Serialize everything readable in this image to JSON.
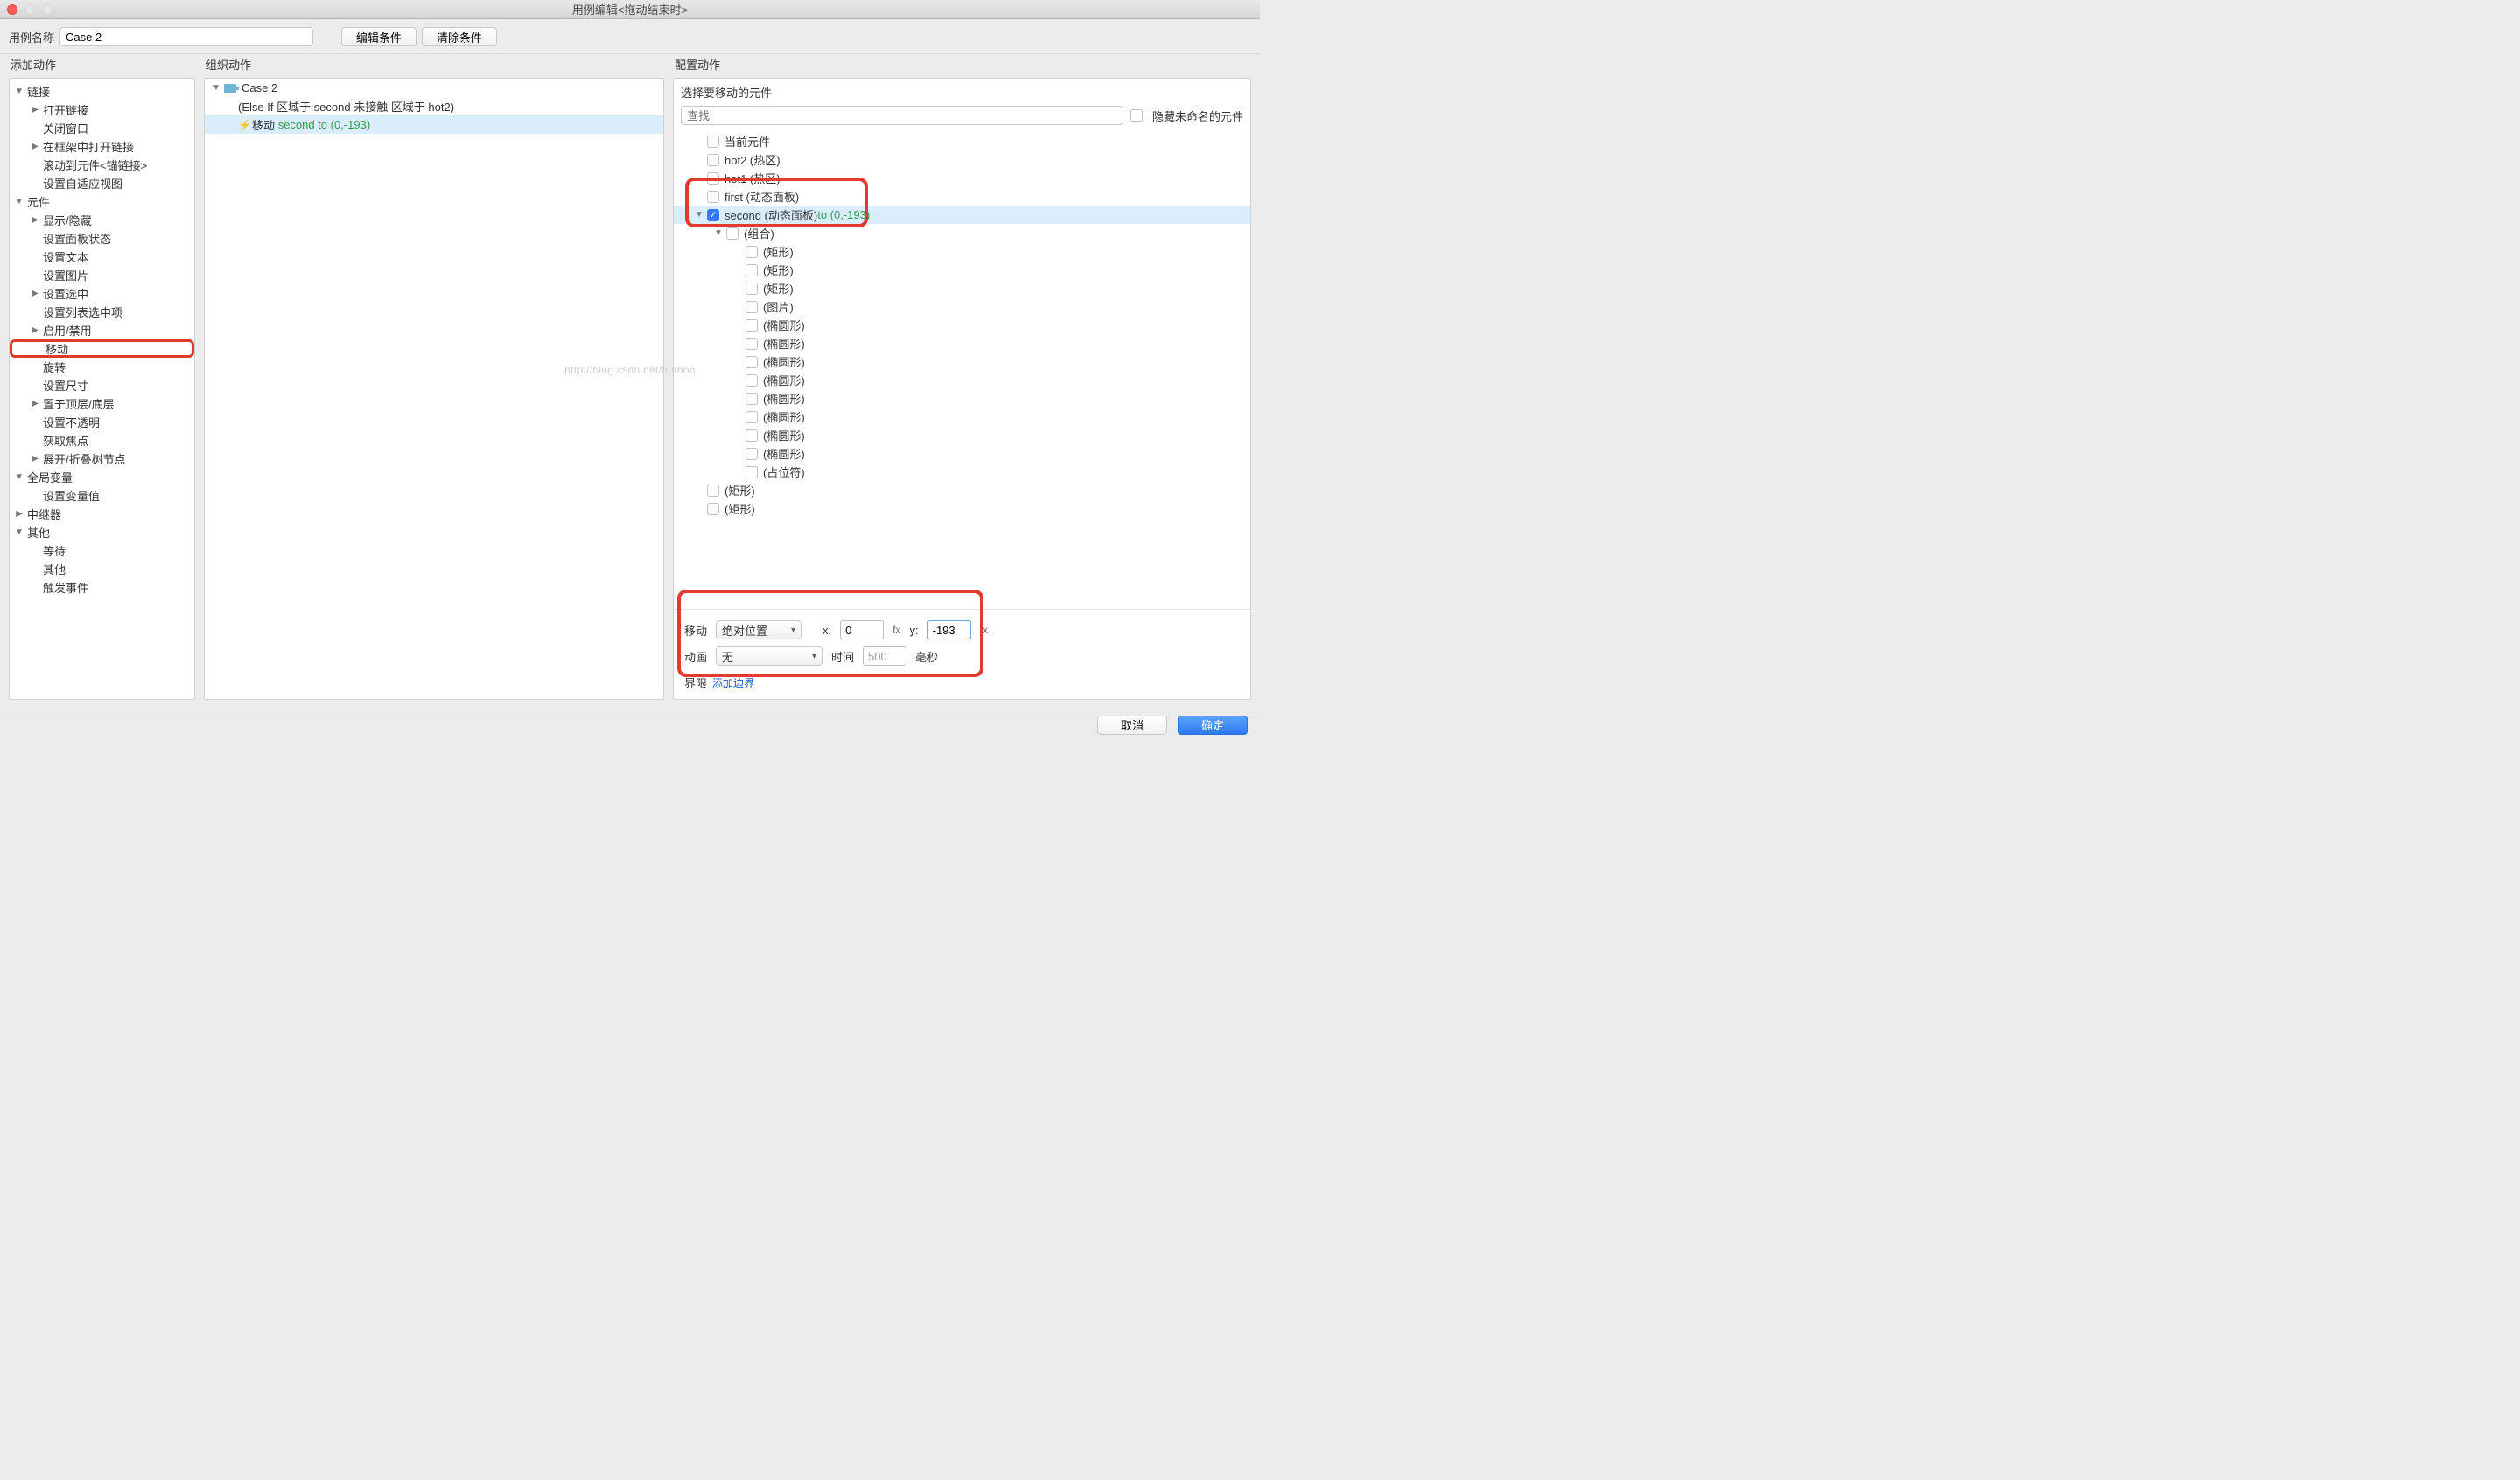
{
  "title": "用例编辑<拖动结束时>",
  "toolbar": {
    "name_label": "用例名称",
    "name_value": "Case 2",
    "edit_btn": "编辑条件",
    "clear_btn": "清除条件"
  },
  "columns": {
    "add_actions": "添加动作",
    "org_actions": "组织动作",
    "cfg_actions": "配置动作"
  },
  "action_tree": [
    {
      "label": "链接",
      "level": 0,
      "expanded": true
    },
    {
      "label": "打开链接",
      "level": 1,
      "chev": true
    },
    {
      "label": "关闭窗口",
      "level": 1
    },
    {
      "label": "在框架中打开链接",
      "level": 1,
      "chev": true
    },
    {
      "label": "滚动到元件<锚链接>",
      "level": 1
    },
    {
      "label": "设置自适应视图",
      "level": 1
    },
    {
      "label": "元件",
      "level": 0,
      "expanded": true
    },
    {
      "label": "显示/隐藏",
      "level": 1,
      "chev": true
    },
    {
      "label": "设置面板状态",
      "level": 1
    },
    {
      "label": "设置文本",
      "level": 1
    },
    {
      "label": "设置图片",
      "level": 1
    },
    {
      "label": "设置选中",
      "level": 1,
      "chev": true
    },
    {
      "label": "设置列表选中项",
      "level": 1
    },
    {
      "label": "启用/禁用",
      "level": 1,
      "chev": true
    },
    {
      "label": "移动",
      "level": 1,
      "hl": true
    },
    {
      "label": "旋转",
      "level": 1
    },
    {
      "label": "设置尺寸",
      "level": 1
    },
    {
      "label": "置于顶层/底层",
      "level": 1,
      "chev": true
    },
    {
      "label": "设置不透明",
      "level": 1
    },
    {
      "label": "获取焦点",
      "level": 1
    },
    {
      "label": "展开/折叠树节点",
      "level": 1,
      "chev": true
    },
    {
      "label": "全局变量",
      "level": 0,
      "expanded": true
    },
    {
      "label": "设置变量值",
      "level": 1
    },
    {
      "label": "中继器",
      "level": 0,
      "collapsed": true
    },
    {
      "label": "其他",
      "level": 0,
      "expanded": true
    },
    {
      "label": "等待",
      "level": 1
    },
    {
      "label": "其他",
      "level": 1
    },
    {
      "label": "触发事件",
      "level": 1
    }
  ],
  "org": {
    "case_name": "Case 2",
    "case_cond": "(Else If 区域于 second 未接触 区域于 hot2)",
    "action_prefix": "移动",
    "action_detail": "second to (0,-193)"
  },
  "cfg": {
    "select_label": "选择要移动的元件",
    "search_placeholder": "查找",
    "hide_unnamed": "隐藏未命名的元件",
    "widgets": [
      {
        "label": "当前元件",
        "level": 0
      },
      {
        "label": "hot2 (热区)",
        "level": 0
      },
      {
        "label": "hot1 (热区)",
        "level": 0
      },
      {
        "label": "first (动态面板)",
        "level": 0
      },
      {
        "label": "second (动态面板)",
        "extra": "to (0,-193)",
        "level": 0,
        "checked": true,
        "selected": true,
        "disc": "down"
      },
      {
        "label": "(组合)",
        "level": 1,
        "disc": "down"
      },
      {
        "label": "(矩形)",
        "level": 2
      },
      {
        "label": "(矩形)",
        "level": 2
      },
      {
        "label": "(矩形)",
        "level": 2
      },
      {
        "label": "(图片)",
        "level": 2
      },
      {
        "label": "(椭圆形)",
        "level": 2
      },
      {
        "label": "(椭圆形)",
        "level": 2
      },
      {
        "label": "(椭圆形)",
        "level": 2
      },
      {
        "label": "(椭圆形)",
        "level": 2
      },
      {
        "label": "(椭圆形)",
        "level": 2
      },
      {
        "label": "(椭圆形)",
        "level": 2
      },
      {
        "label": "(椭圆形)",
        "level": 2
      },
      {
        "label": "(椭圆形)",
        "level": 2
      },
      {
        "label": "(占位符)",
        "level": 2
      },
      {
        "label": "(矩形)",
        "level": 0
      },
      {
        "label": "(矩形)",
        "level": 0
      }
    ]
  },
  "move_panel": {
    "move_label": "移动",
    "move_type": "绝对位置",
    "x_label": "x:",
    "x_val": "0",
    "y_label": "y:",
    "y_val": "-193",
    "fx": "fx",
    "anim_label": "动画",
    "anim_type": "无",
    "time_label": "时间",
    "time_val": "500",
    "ms": "毫秒",
    "bounds_label": "界限",
    "bounds_link": "添加边界"
  },
  "footer": {
    "cancel": "取消",
    "ok": "确定"
  },
  "watermark": "http://blog.csdn.net/hutbon"
}
